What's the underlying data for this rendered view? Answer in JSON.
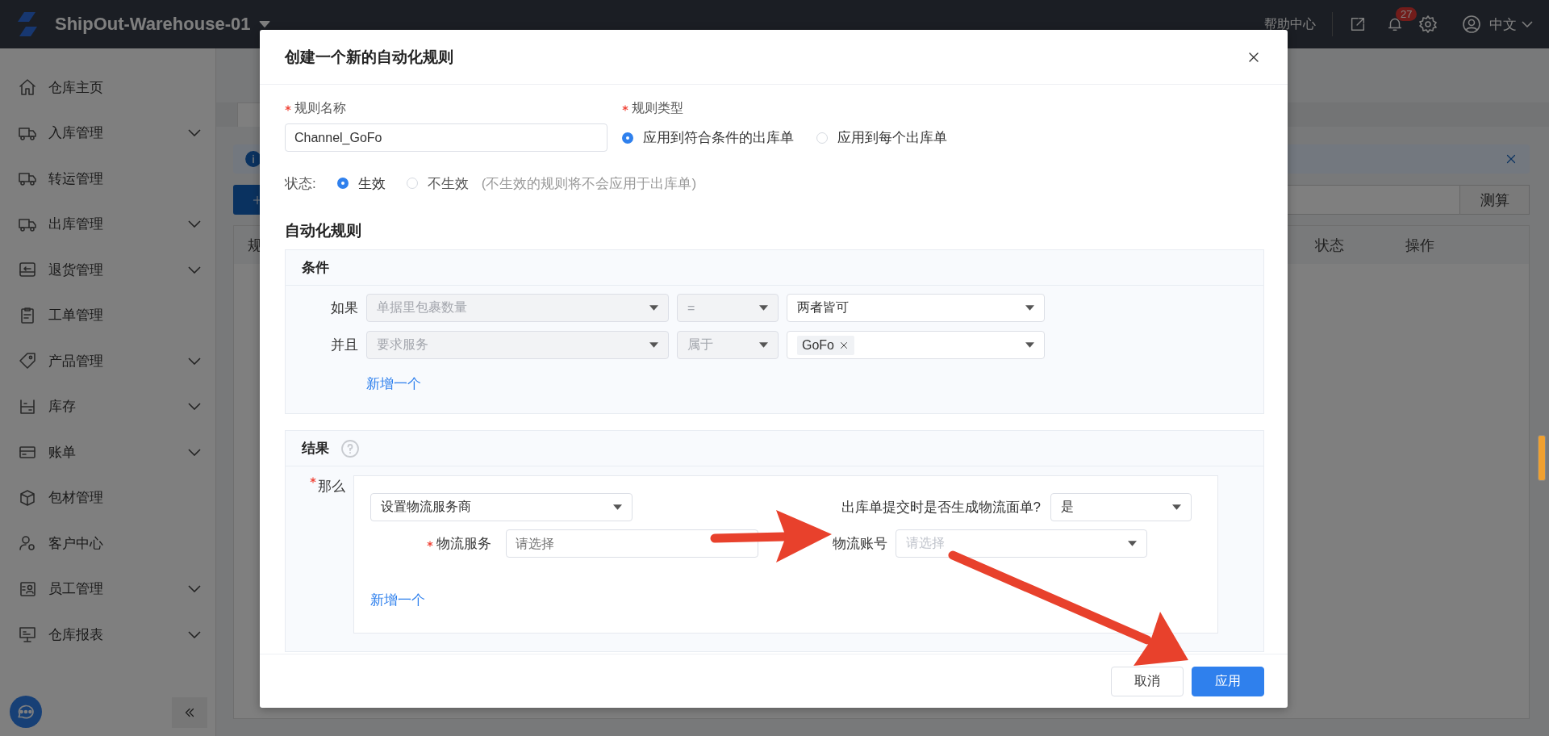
{
  "top_bar": {
    "warehouse": "ShipOut-Warehouse-01",
    "help": "帮助中心",
    "notification_count": "27",
    "language": "中文"
  },
  "sidebar": {
    "items": [
      {
        "label": "仓库主页",
        "expandable": false
      },
      {
        "label": "入库管理",
        "expandable": true
      },
      {
        "label": "转运管理",
        "expandable": false
      },
      {
        "label": "出库管理",
        "expandable": true
      },
      {
        "label": "退货管理",
        "expandable": true
      },
      {
        "label": "工单管理",
        "expandable": false
      },
      {
        "label": "产品管理",
        "expandable": true
      },
      {
        "label": "库存",
        "expandable": true
      },
      {
        "label": "账单",
        "expandable": true
      },
      {
        "label": "包材管理",
        "expandable": false
      },
      {
        "label": "客户中心",
        "expandable": false
      },
      {
        "label": "员工管理",
        "expandable": true
      },
      {
        "label": "仓库报表",
        "expandable": true
      }
    ]
  },
  "page": {
    "search_button": "测算",
    "columns": [
      "规",
      "状态",
      "操作"
    ]
  },
  "dialog": {
    "title": "创建一个新的自动化规则",
    "name_field": {
      "label": "规则名称",
      "required": true,
      "value": "Channel_GoFo"
    },
    "type_field": {
      "label": "规则类型",
      "required": true,
      "options": [
        {
          "label": "应用到符合条件的出库单",
          "selected": true
        },
        {
          "label": "应用到每个出库单",
          "selected": false
        }
      ]
    },
    "status": {
      "label": "状态:",
      "options": [
        {
          "label": "生效",
          "selected": true
        },
        {
          "label": "不生效",
          "selected": false,
          "note": "(不生效的规则将不会应用于出库单)"
        }
      ]
    },
    "section_title": "自动化规则",
    "conditions": {
      "title": "条件",
      "rows": [
        {
          "connector": "如果",
          "field": {
            "value": "单据里包裹数量",
            "disabled": true
          },
          "operator": {
            "value": "=",
            "disabled": true
          },
          "value": {
            "value": "两者皆可"
          }
        },
        {
          "connector": "并且",
          "field": {
            "value": "要求服务",
            "disabled": true
          },
          "operator": {
            "value": "属于",
            "disabled": true
          },
          "value": {
            "tags": [
              "GoFo"
            ]
          }
        }
      ],
      "add_link": "新增一个"
    },
    "results": {
      "title": "结果",
      "label": "那么",
      "required": true,
      "action": "设置物流服务商",
      "generate_label": {
        "label": "出库单提交时是否生成物流面单?",
        "value": "是"
      },
      "fields": [
        {
          "label": "物流服务",
          "required": true,
          "placeholder": "请选择",
          "kind": "input"
        },
        {
          "label": "物流账号",
          "required": false,
          "placeholder": "请选择",
          "kind": "select"
        }
      ],
      "add_link": "新增一个"
    },
    "buttons": [
      {
        "label": "取消",
        "kind": "default"
      },
      {
        "label": "应用",
        "kind": "primary"
      }
    ]
  }
}
